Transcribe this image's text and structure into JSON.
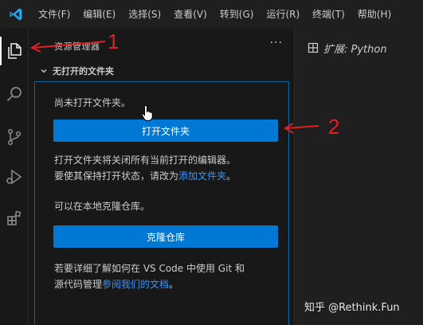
{
  "menubar": {
    "items": [
      "文件(F)",
      "编辑(E)",
      "选择(S)",
      "查看(V)",
      "转到(G)",
      "运行(R)",
      "终端(T)",
      "帮助(H)"
    ]
  },
  "activitybar": {
    "icons": [
      "explorer-icon",
      "search-icon",
      "source-control-icon",
      "run-debug-icon",
      "extensions-icon"
    ]
  },
  "sidebar": {
    "title": "资源管理器",
    "more": "···",
    "section_title": "无打开的文件夹",
    "welcome": {
      "no_folder_text": "尚未打开文件夹。",
      "open_folder_button": "打开文件夹",
      "close_editors_text": "打开文件夹将关闭所有当前打开的编辑器。",
      "keep_open_prefix": "要使其保持打开状态，请改为",
      "add_folder_link": "添加文件夹",
      "keep_open_suffix": "。",
      "clone_local_text": "可以在本地克隆仓库。",
      "clone_button": "克隆仓库",
      "learn_more_line1": "若要详细了解如何在 VS Code 中使用 Git 和",
      "learn_more_prefix": "源代码管理",
      "docs_link": "参阅我们的文档",
      "learn_more_suffix": "。"
    }
  },
  "editor": {
    "tab_label": "扩展: Python"
  },
  "annotations": {
    "label_1": "1",
    "label_2": "2",
    "color": "#e02020"
  },
  "watermark": "知乎 @Rethink.Fun",
  "colors": {
    "accent": "#0078d4",
    "link": "#3794ff",
    "focus_border": "#0e639c",
    "logo": "#23a9f2"
  }
}
